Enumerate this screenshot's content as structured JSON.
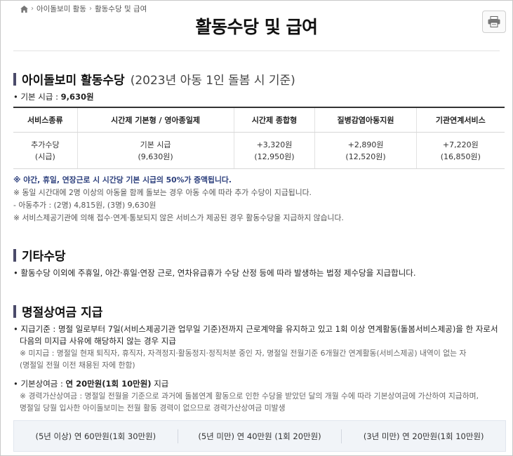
{
  "breadcrumb": {
    "items": [
      "아이돌보미 활동",
      "활동수당 및 급여"
    ]
  },
  "page_title": "활동수당 및 급여",
  "print_icon": "printer-icon",
  "section1": {
    "title": "아이돌보미 활동수당",
    "subtitle": "(2023년 아동 1인 돌봄 시 기준)",
    "base_label": "기본 시급 : ",
    "base_value": "9,630원",
    "table": {
      "headers": [
        "서비스종류",
        "시간제 기본형 / 영아종일제",
        "시간제 종합형",
        "질병감염아동지원",
        "기관연계서비스"
      ],
      "row": [
        {
          "l1": "추가수당",
          "l2": "(시급)"
        },
        {
          "l1": "기본 시급",
          "l2": "(9,630원)"
        },
        {
          "l1": "+3,320원",
          "l2": "(12,950원)"
        },
        {
          "l1": "+2,890원",
          "l2": "(12,520원)"
        },
        {
          "l1": "+7,220원",
          "l2": "(16,850원)"
        }
      ]
    },
    "notes": [
      "※ 야간, 휴일, 연장근로 시 시간당 기본 시급의 50%가 증액됩니다.",
      "※ 동일 시간대에 2명 이상의 아동을 함께 돌보는 경우 아동 수에 따라 추가 수당이 지급됩니다.",
      "- 아동추가 : (2명) 4,815원, (3명) 9,630원",
      "※ 서비스제공기관에 의해 접수·연계·통보되지 않은 서비스가 제공된 경우 활동수당을 지급하지 않습니다."
    ]
  },
  "section2": {
    "title": "기타수당",
    "text": "활동수당 이외에 주휴일, 야간·휴일·연장 근로, 연차유급휴가 수당 산정 등에 따라 발생하는 법정 제수당을 지급합니다."
  },
  "section3": {
    "title": "명절상여금 지급",
    "criteria_line1": "지급기준 : 명절 일로부터 7일(서비스제공기관 업무일 기준)전까지 근로계약을 유지하고 있고 1회 이상 연계활동(돌봄서비스제공)을 한 자로서",
    "criteria_line2": "다음의 미지급 사유에 해당하지 않는 경우 지급",
    "exclude_line1": "※ 미지급 : 명절일 현재 퇴직자, 휴직자, 자격정지·활동정지·정직처분 중인 자, 명절일 전월기준 6개월간 연계활동(서비스제공) 내역이 없는 자",
    "exclude_line2": "(명절일 전월 이전 채용된 자에 한함)",
    "basic_label": "기본상여금 : ",
    "basic_value": "연 20만원(1회 10만원)",
    "basic_suffix": " 지급",
    "career_line1": "※ 경력가산상여금 : 명절일 전월을 기준으로 과거에 돌봄연계 활동으로 인한 수당을 받았던 달의 개월 수에 따라 기본상여금에 가산하여 지급하며,",
    "career_line2": "명절일 당월 입사한 아이돌보미는 전월 활동 경력이 없으므로 경력가산상여금 미발생",
    "tiers": [
      "(5년 이상) 연 60만원(1회 30만원)",
      "(5년 미만) 연 40만원 (1회 20만원)",
      "(3년 미만) 연 20만원(1회 10만원)"
    ]
  }
}
